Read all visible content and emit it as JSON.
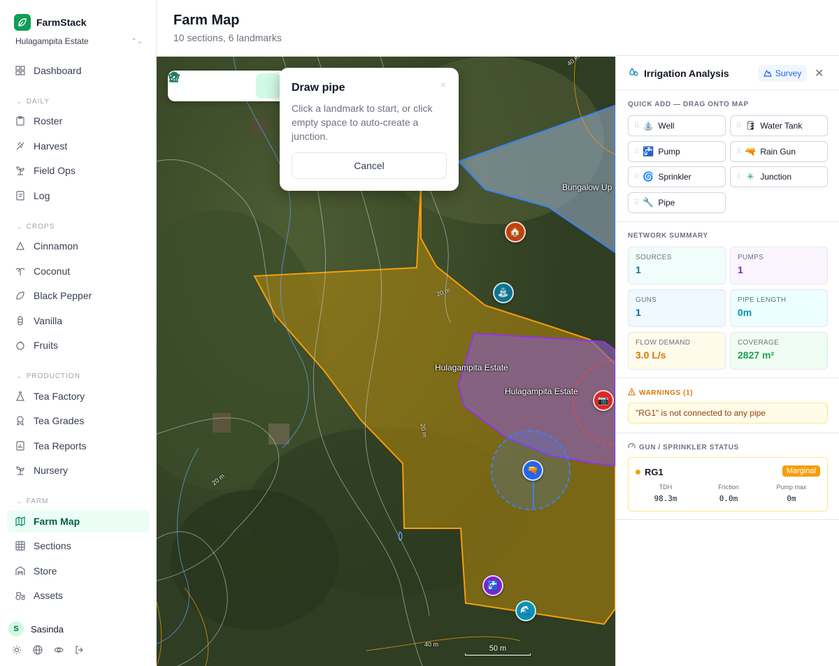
{
  "brand": {
    "name": "FarmStack",
    "estate": "Hulagampita Estate"
  },
  "nav": {
    "dashboard": "Dashboard",
    "groups": {
      "daily": "DAILY",
      "crops": "CROPS",
      "production": "PRODUCTION",
      "farm": "FARM"
    },
    "daily": [
      "Roster",
      "Harvest",
      "Field Ops",
      "Log"
    ],
    "crops": [
      "Cinnamon",
      "Coconut",
      "Black Pepper",
      "Vanilla",
      "Fruits"
    ],
    "production": [
      "Tea Factory",
      "Tea Grades",
      "Tea Reports",
      "Nursery"
    ],
    "farm": [
      "Farm Map",
      "Sections",
      "Store",
      "Assets"
    ]
  },
  "user": {
    "initial": "S",
    "name": "Sasinda"
  },
  "header": {
    "title": "Farm Map",
    "subtitle": "10 sections, 6 landmarks"
  },
  "map": {
    "labels": [
      "Bungalow Up",
      "Hulagampita Estate",
      "Hulagampita Estate"
    ],
    "contours": [
      "20 m",
      "20 m",
      "20 m",
      "40 m",
      "40 m"
    ],
    "scale": "50 m"
  },
  "popover": {
    "title": "Draw pipe",
    "body": "Click a landmark to start, or click empty space to auto-create a junction.",
    "cancel": "Cancel",
    "close": "×"
  },
  "panel": {
    "title": "Irrigation Analysis",
    "survey": "Survey",
    "quick_add_label": "QUICK ADD — DRAG ONTO MAP",
    "quick_add": [
      {
        "label": "Well",
        "icon": "⛲"
      },
      {
        "label": "Water Tank",
        "icon": "🛢"
      },
      {
        "label": "Pump",
        "icon": "🚰"
      },
      {
        "label": "Rain Gun",
        "icon": "🔫"
      },
      {
        "label": "Sprinkler",
        "icon": "🌀"
      },
      {
        "label": "Junction",
        "icon": "✳"
      },
      {
        "label": "Pipe",
        "icon": "🔧"
      }
    ],
    "summary_label": "NETWORK SUMMARY",
    "stats": [
      {
        "label": "SOURCES",
        "value": "1",
        "color": "#0e7490",
        "bg": "#f0fdfa"
      },
      {
        "label": "PUMPS",
        "value": "1",
        "color": "#7e22ce",
        "bg": "#faf5ff"
      },
      {
        "label": "GUNS",
        "value": "1",
        "color": "#0369a1",
        "bg": "#f0f9ff"
      },
      {
        "label": "PIPE LENGTH",
        "value": "0m",
        "color": "#0891b2",
        "bg": "#ecfeff"
      },
      {
        "label": "FLOW DEMAND",
        "value": "3.0 L/s",
        "color": "#d97706",
        "bg": "#fffbeb"
      },
      {
        "label": "COVERAGE",
        "value": "2827 m²",
        "color": "#16a34a",
        "bg": "#f0fdf4"
      }
    ],
    "warnings_label": "WARNINGS (1)",
    "warning": "\"RG1\" is not connected to any pipe",
    "status_label": "GUN / SPRINKLER STATUS",
    "gun": {
      "name": "RG1",
      "badge": "Marginal",
      "cols": [
        {
          "label": "TDH",
          "value": "98.3m"
        },
        {
          "label": "Friction",
          "value": "0.0m"
        },
        {
          "label": "Pump max",
          "value": "0m"
        }
      ]
    }
  }
}
